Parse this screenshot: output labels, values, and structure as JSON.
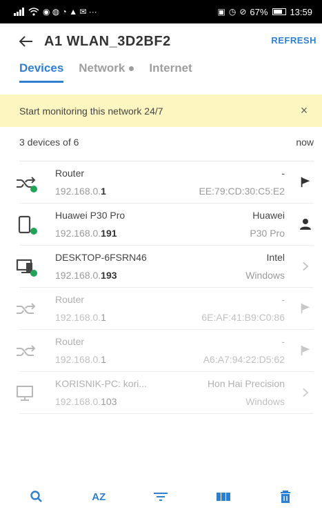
{
  "statusbar": {
    "left_icons": "signal-wifi-notification-icons",
    "battery": "67%",
    "time": "13:59"
  },
  "appbar": {
    "title": "A1 WLAN_3D2BF2",
    "refresh_label": "REFRESH"
  },
  "tabs": [
    {
      "label": "Devices",
      "active": true
    },
    {
      "label": "Network",
      "active": false,
      "dot": true
    },
    {
      "label": "Internet",
      "active": false
    }
  ],
  "banner": {
    "text": "Start monitoring this network 24/7",
    "close_glyph": "×"
  },
  "summary": {
    "count": "3 devices of 6",
    "updated": "now"
  },
  "devices": [
    {
      "name": "Router",
      "ip_prefix": "192.168.0.",
      "ip_suffix": "1",
      "vendor": "-",
      "detail": "EE:79:CD:30:C5:E2",
      "icon": "router-icon",
      "online": true,
      "action": "flag-icon",
      "dim": false
    },
    {
      "name": "Huawei P30 Pro",
      "ip_prefix": "192.168.0.",
      "ip_suffix": "191",
      "vendor": "Huawei",
      "detail": "P30 Pro",
      "icon": "phone-icon",
      "online": true,
      "action": "person-icon",
      "dim": false
    },
    {
      "name": "DESKTOP-6FSRN46",
      "ip_prefix": "192.168.0.",
      "ip_suffix": "193",
      "vendor": "Intel",
      "detail": "Windows",
      "icon": "desktop-icon",
      "online": true,
      "action": "chevron-right-icon",
      "dim": false
    },
    {
      "name": "Router",
      "ip_prefix": "192.168.0.",
      "ip_suffix": "1",
      "vendor": "-",
      "detail": "6E:AF:41:B9:C0:86",
      "icon": "router-icon",
      "online": false,
      "action": "flag-icon",
      "dim": true
    },
    {
      "name": "Router",
      "ip_prefix": "192.168.0.",
      "ip_suffix": "1",
      "vendor": "-",
      "detail": "A6:A7:94:22:D5:62",
      "icon": "router-icon",
      "online": false,
      "action": "flag-icon",
      "dim": true
    },
    {
      "name": "KORISNIK-PC: kori...",
      "ip_prefix": "192.168.0.",
      "ip_suffix": "103",
      "vendor": "Hon Hai Precision",
      "detail": "Windows",
      "icon": "monitor-icon",
      "online": false,
      "action": "chevron-right-icon",
      "dim": true
    }
  ],
  "bottombar": {
    "sort_label": "AZ",
    "items": [
      "search-icon",
      "sort-az-icon",
      "filter-icon",
      "columns-icon",
      "delete-icon"
    ]
  },
  "colors": {
    "accent": "#2f7fd1",
    "online": "#21a35a",
    "banner_bg": "#fdf6c0"
  }
}
